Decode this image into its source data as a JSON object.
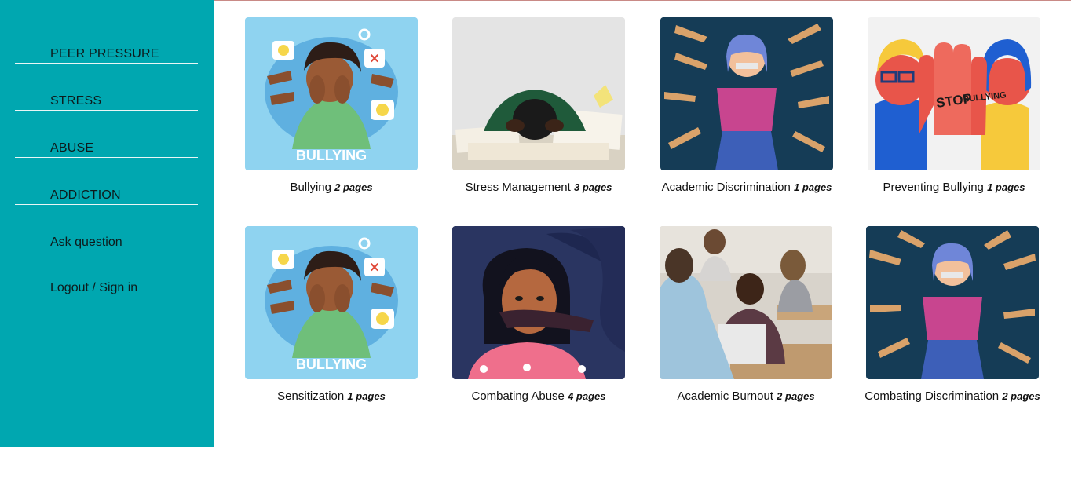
{
  "sidebar": {
    "categories": [
      {
        "label": "PEER PRESSURE"
      },
      {
        "label": "STRESS"
      },
      {
        "label": "ABUSE"
      },
      {
        "label": "ADDICTION"
      }
    ],
    "ask_question": "Ask question",
    "auth_link": "Logout / Sign in"
  },
  "topics": [
    {
      "title": "Bullying",
      "pages": "2 pages",
      "thumbnail_text": "BULLYING"
    },
    {
      "title": "Stress Management",
      "pages": "3 pages"
    },
    {
      "title": "Academic Discrimination",
      "pages": "1 pages"
    },
    {
      "title": "Preventing Bullying",
      "pages": "1 pages",
      "thumbnail_text": [
        "STOP",
        "BULLYING"
      ]
    },
    {
      "title": "Sensitization",
      "pages": "1 pages",
      "thumbnail_text": "BULLYING"
    },
    {
      "title": "Combating Abuse",
      "pages": "4 pages"
    },
    {
      "title": "Academic Burnout",
      "pages": "2 pages"
    },
    {
      "title": "Combating Discrimination",
      "pages": "2 pages"
    }
  ],
  "colors": {
    "sidebar": "#00a7b0",
    "bullying_bg": "#8fd3f0",
    "discrimination_bg": "#153c56",
    "abuse_bg": "#2a3561"
  }
}
